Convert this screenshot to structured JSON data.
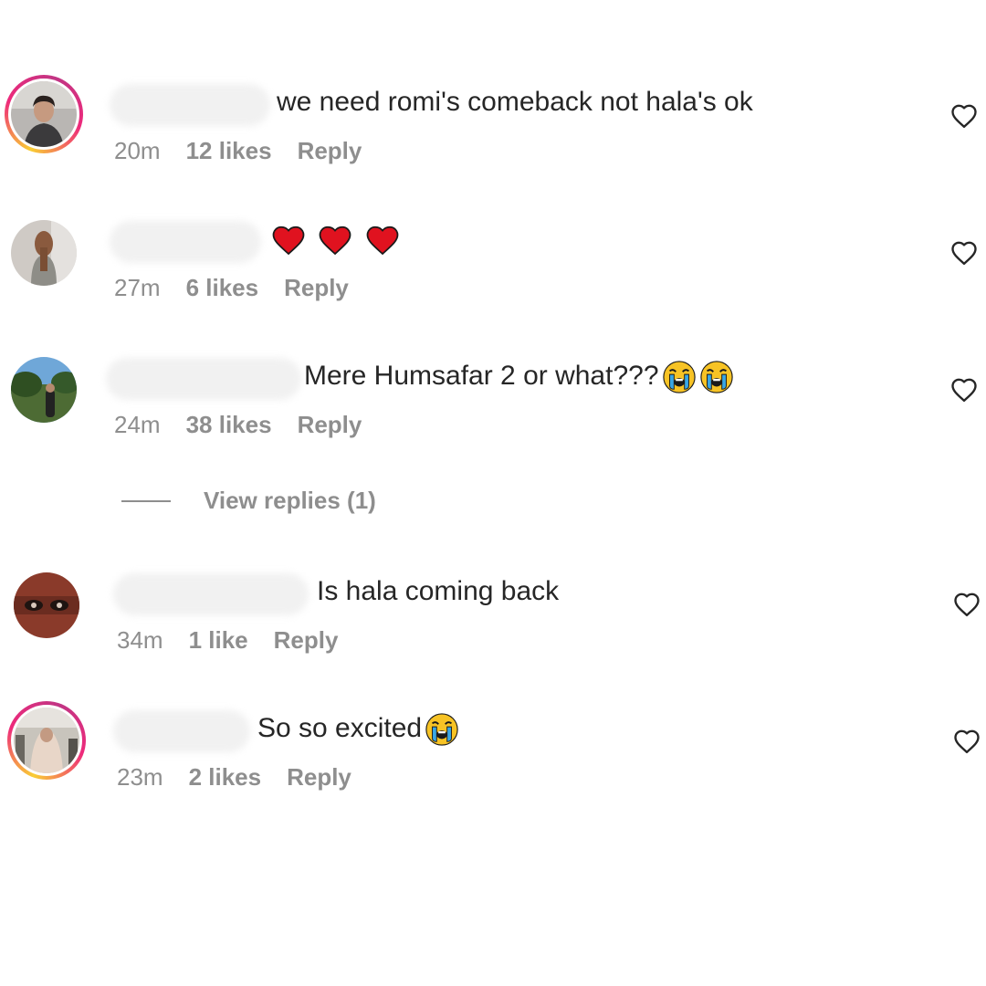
{
  "colors": {
    "text_primary": "#262626",
    "text_secondary": "#8e8e8e",
    "story_ring_start": "#f9ce34",
    "story_ring_end": "#c13584"
  },
  "comments": [
    {
      "text": "we need romi's comeback not hala's ok",
      "time": "20m",
      "likes": "12 likes",
      "reply": "Reply",
      "has_story_ring": true,
      "icon": "heart-outline-icon"
    },
    {
      "text": "",
      "emojis": [
        "red-heart-emoji",
        "red-heart-emoji",
        "red-heart-emoji"
      ],
      "time": "27m",
      "likes": "6 likes",
      "reply": "Reply",
      "has_story_ring": false,
      "icon": "heart-outline-icon"
    },
    {
      "text": "Mere Humsafar 2 or what???",
      "emojis": [
        "loudly-crying-emoji",
        "loudly-crying-emoji"
      ],
      "time": "24m",
      "likes": "38 likes",
      "reply": "Reply",
      "has_story_ring": false,
      "icon": "heart-outline-icon"
    },
    {
      "text": "Is hala coming back",
      "time": "34m",
      "likes": "1 like",
      "reply": "Reply",
      "has_story_ring": false,
      "icon": "heart-outline-icon"
    },
    {
      "text": "So so excited",
      "emojis": [
        "loudly-crying-emoji"
      ],
      "time": "23m",
      "likes": "2 likes",
      "reply": "Reply",
      "has_story_ring": true,
      "icon": "heart-outline-icon"
    }
  ],
  "view_replies": "View replies (1)"
}
